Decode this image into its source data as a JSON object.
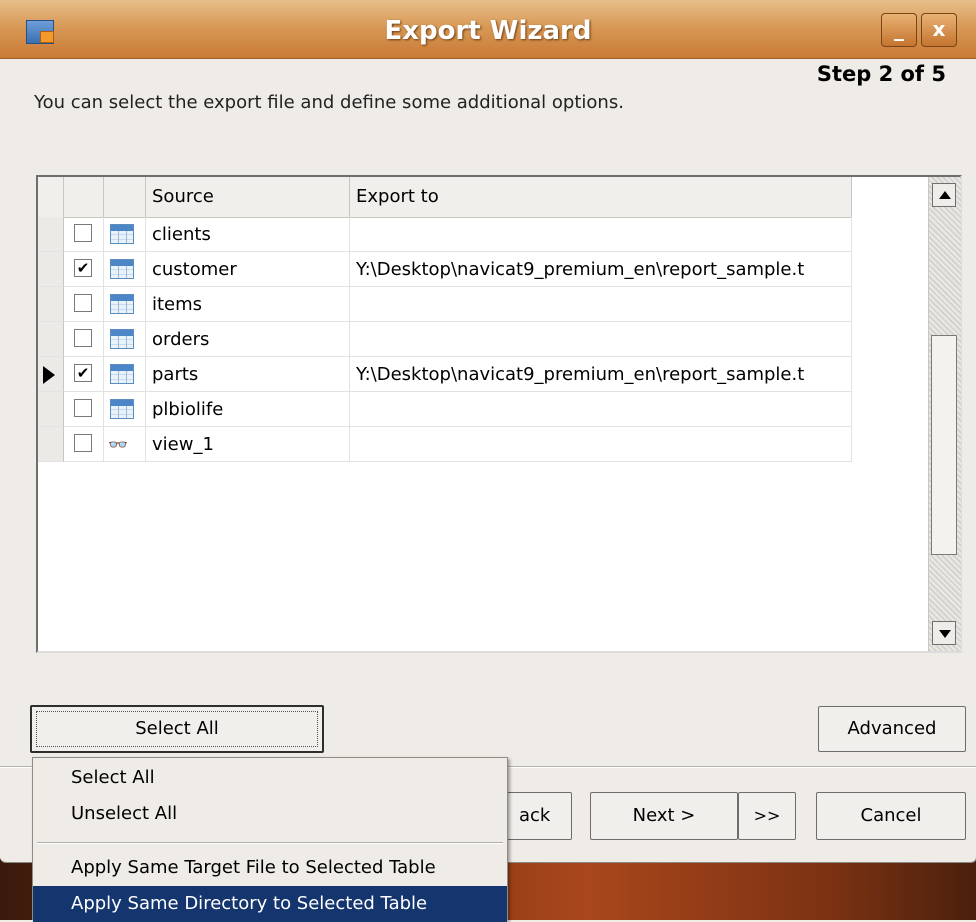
{
  "window": {
    "title": "Export Wizard",
    "minimize_label": "_",
    "close_label": "x",
    "step": "Step 2 of 5",
    "instructions": "You can select the export file and define some additional options."
  },
  "grid": {
    "columns": [
      "Source",
      "Export to"
    ],
    "rows": [
      {
        "source": "clients",
        "export_to": "",
        "checked": false,
        "icon": "table-icon",
        "current": false
      },
      {
        "source": "customer",
        "export_to": "Y:\\Desktop\\navicat9_premium_en\\report_sample.t",
        "checked": true,
        "icon": "table-icon",
        "current": false
      },
      {
        "source": "items",
        "export_to": "",
        "checked": false,
        "icon": "table-icon",
        "current": false
      },
      {
        "source": "orders",
        "export_to": "",
        "checked": false,
        "icon": "table-icon",
        "current": false
      },
      {
        "source": "parts",
        "export_to": "Y:\\Desktop\\navicat9_premium_en\\report_sample.t",
        "checked": true,
        "icon": "table-icon",
        "current": true
      },
      {
        "source": "plbiolife",
        "export_to": "",
        "checked": false,
        "icon": "table-icon",
        "current": false
      },
      {
        "source": "view_1",
        "export_to": "",
        "checked": false,
        "icon": "view-icon",
        "current": false
      }
    ]
  },
  "buttons": {
    "select_all": "Select All",
    "advanced": "Advanced",
    "back": "ack",
    "next": "Next >",
    "last": ">>",
    "cancel": "Cancel"
  },
  "menu": {
    "items": [
      "Select All",
      "Unselect All",
      "Apply Same Target File to Selected Table",
      "Apply Same Directory to Selected Table"
    ],
    "highlighted_index": 3
  },
  "colors": {
    "titlebar": "#d89a57",
    "menu_highlight": "#15356f"
  }
}
